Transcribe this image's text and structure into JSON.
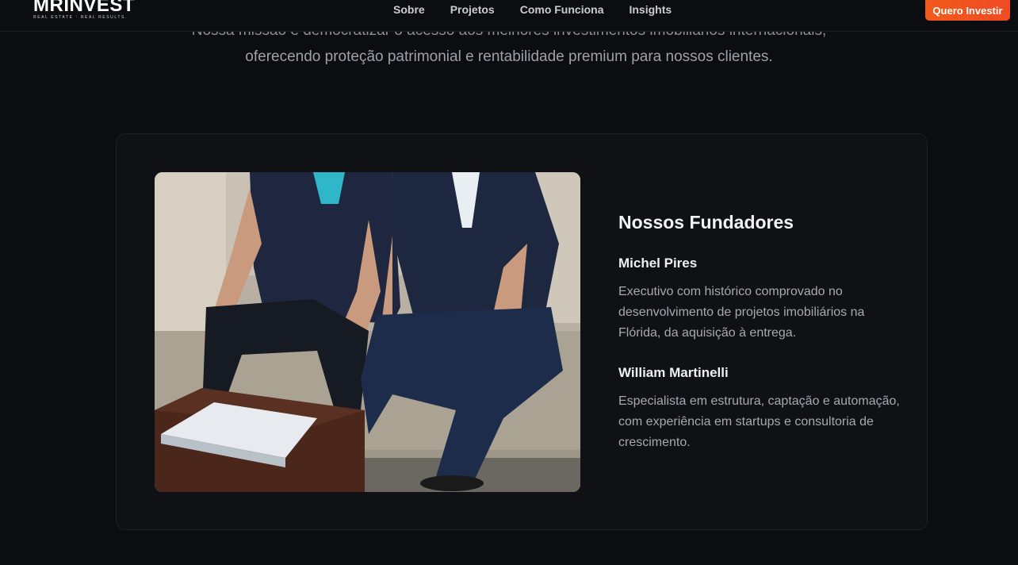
{
  "header": {
    "logo": {
      "name": "MRINVEST",
      "tagline": "REAL ESTATE · REAL RESULTS."
    },
    "nav": [
      {
        "label": "Sobre"
      },
      {
        "label": "Projetos"
      },
      {
        "label": "Como Funciona"
      },
      {
        "label": "Insights"
      }
    ],
    "cta_label": "Quero Investir"
  },
  "mission": {
    "line1": "Nossa missão é democratizar o acesso aos melhores investimentos imobiliários internacionais,",
    "line2": "oferecendo proteção patrimonial e rentabilidade premium para nossos clientes."
  },
  "founders": {
    "title": "Nossos Fundadores",
    "people": [
      {
        "name": "Michel Pires",
        "bio": "Executivo com histórico comprovado no desenvolvimento de projetos imobiliários na Flórida, da aquisição à entrega."
      },
      {
        "name": "William Martinelli",
        "bio": "Especialista em estrutura, captação e automação, com experiência em startups e consultoria de crescimento."
      }
    ]
  },
  "colors": {
    "background": "#0b0d10",
    "card": "#0f1115",
    "accent": "#f25a1b",
    "text_primary": "#f2f3f5",
    "text_secondary": "#a5a9b0"
  },
  "icons": {
    "photo": "founders-photo"
  }
}
